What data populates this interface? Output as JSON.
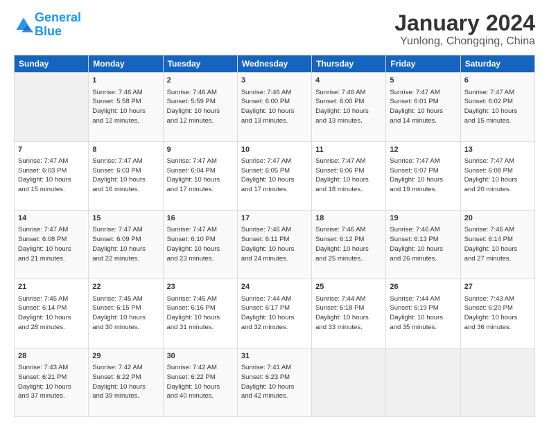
{
  "logo": {
    "text_general": "General",
    "text_blue": "Blue"
  },
  "header": {
    "title": "January 2024",
    "subtitle": "Yunlong, Chongqing, China"
  },
  "days_of_week": [
    "Sunday",
    "Monday",
    "Tuesday",
    "Wednesday",
    "Thursday",
    "Friday",
    "Saturday"
  ],
  "weeks": [
    [
      {
        "day": "",
        "sunrise": "",
        "sunset": "",
        "daylight": ""
      },
      {
        "day": "1",
        "sunrise": "Sunrise: 7:46 AM",
        "sunset": "Sunset: 5:58 PM",
        "daylight": "Daylight: 10 hours and 12 minutes."
      },
      {
        "day": "2",
        "sunrise": "Sunrise: 7:46 AM",
        "sunset": "Sunset: 5:59 PM",
        "daylight": "Daylight: 10 hours and 12 minutes."
      },
      {
        "day": "3",
        "sunrise": "Sunrise: 7:46 AM",
        "sunset": "Sunset: 6:00 PM",
        "daylight": "Daylight: 10 hours and 13 minutes."
      },
      {
        "day": "4",
        "sunrise": "Sunrise: 7:46 AM",
        "sunset": "Sunset: 6:00 PM",
        "daylight": "Daylight: 10 hours and 13 minutes."
      },
      {
        "day": "5",
        "sunrise": "Sunrise: 7:47 AM",
        "sunset": "Sunset: 6:01 PM",
        "daylight": "Daylight: 10 hours and 14 minutes."
      },
      {
        "day": "6",
        "sunrise": "Sunrise: 7:47 AM",
        "sunset": "Sunset: 6:02 PM",
        "daylight": "Daylight: 10 hours and 15 minutes."
      }
    ],
    [
      {
        "day": "7",
        "sunrise": "Sunrise: 7:47 AM",
        "sunset": "Sunset: 6:03 PM",
        "daylight": "Daylight: 10 hours and 15 minutes."
      },
      {
        "day": "8",
        "sunrise": "Sunrise: 7:47 AM",
        "sunset": "Sunset: 6:03 PM",
        "daylight": "Daylight: 10 hours and 16 minutes."
      },
      {
        "day": "9",
        "sunrise": "Sunrise: 7:47 AM",
        "sunset": "Sunset: 6:04 PM",
        "daylight": "Daylight: 10 hours and 17 minutes."
      },
      {
        "day": "10",
        "sunrise": "Sunrise: 7:47 AM",
        "sunset": "Sunset: 6:05 PM",
        "daylight": "Daylight: 10 hours and 17 minutes."
      },
      {
        "day": "11",
        "sunrise": "Sunrise: 7:47 AM",
        "sunset": "Sunset: 6:06 PM",
        "daylight": "Daylight: 10 hours and 18 minutes."
      },
      {
        "day": "12",
        "sunrise": "Sunrise: 7:47 AM",
        "sunset": "Sunset: 6:07 PM",
        "daylight": "Daylight: 10 hours and 19 minutes."
      },
      {
        "day": "13",
        "sunrise": "Sunrise: 7:47 AM",
        "sunset": "Sunset: 6:08 PM",
        "daylight": "Daylight: 10 hours and 20 minutes."
      }
    ],
    [
      {
        "day": "14",
        "sunrise": "Sunrise: 7:47 AM",
        "sunset": "Sunset: 6:08 PM",
        "daylight": "Daylight: 10 hours and 21 minutes."
      },
      {
        "day": "15",
        "sunrise": "Sunrise: 7:47 AM",
        "sunset": "Sunset: 6:09 PM",
        "daylight": "Daylight: 10 hours and 22 minutes."
      },
      {
        "day": "16",
        "sunrise": "Sunrise: 7:47 AM",
        "sunset": "Sunset: 6:10 PM",
        "daylight": "Daylight: 10 hours and 23 minutes."
      },
      {
        "day": "17",
        "sunrise": "Sunrise: 7:46 AM",
        "sunset": "Sunset: 6:11 PM",
        "daylight": "Daylight: 10 hours and 24 minutes."
      },
      {
        "day": "18",
        "sunrise": "Sunrise: 7:46 AM",
        "sunset": "Sunset: 6:12 PM",
        "daylight": "Daylight: 10 hours and 25 minutes."
      },
      {
        "day": "19",
        "sunrise": "Sunrise: 7:46 AM",
        "sunset": "Sunset: 6:13 PM",
        "daylight": "Daylight: 10 hours and 26 minutes."
      },
      {
        "day": "20",
        "sunrise": "Sunrise: 7:46 AM",
        "sunset": "Sunset: 6:14 PM",
        "daylight": "Daylight: 10 hours and 27 minutes."
      }
    ],
    [
      {
        "day": "21",
        "sunrise": "Sunrise: 7:45 AM",
        "sunset": "Sunset: 6:14 PM",
        "daylight": "Daylight: 10 hours and 28 minutes."
      },
      {
        "day": "22",
        "sunrise": "Sunrise: 7:45 AM",
        "sunset": "Sunset: 6:15 PM",
        "daylight": "Daylight: 10 hours and 30 minutes."
      },
      {
        "day": "23",
        "sunrise": "Sunrise: 7:45 AM",
        "sunset": "Sunset: 6:16 PM",
        "daylight": "Daylight: 10 hours and 31 minutes."
      },
      {
        "day": "24",
        "sunrise": "Sunrise: 7:44 AM",
        "sunset": "Sunset: 6:17 PM",
        "daylight": "Daylight: 10 hours and 32 minutes."
      },
      {
        "day": "25",
        "sunrise": "Sunrise: 7:44 AM",
        "sunset": "Sunset: 6:18 PM",
        "daylight": "Daylight: 10 hours and 33 minutes."
      },
      {
        "day": "26",
        "sunrise": "Sunrise: 7:44 AM",
        "sunset": "Sunset: 6:19 PM",
        "daylight": "Daylight: 10 hours and 35 minutes."
      },
      {
        "day": "27",
        "sunrise": "Sunrise: 7:43 AM",
        "sunset": "Sunset: 6:20 PM",
        "daylight": "Daylight: 10 hours and 36 minutes."
      }
    ],
    [
      {
        "day": "28",
        "sunrise": "Sunrise: 7:43 AM",
        "sunset": "Sunset: 6:21 PM",
        "daylight": "Daylight: 10 hours and 37 minutes."
      },
      {
        "day": "29",
        "sunrise": "Sunrise: 7:42 AM",
        "sunset": "Sunset: 6:22 PM",
        "daylight": "Daylight: 10 hours and 39 minutes."
      },
      {
        "day": "30",
        "sunrise": "Sunrise: 7:42 AM",
        "sunset": "Sunset: 6:22 PM",
        "daylight": "Daylight: 10 hours and 40 minutes."
      },
      {
        "day": "31",
        "sunrise": "Sunrise: 7:41 AM",
        "sunset": "Sunset: 6:23 PM",
        "daylight": "Daylight: 10 hours and 42 minutes."
      },
      {
        "day": "",
        "sunrise": "",
        "sunset": "",
        "daylight": ""
      },
      {
        "day": "",
        "sunrise": "",
        "sunset": "",
        "daylight": ""
      },
      {
        "day": "",
        "sunrise": "",
        "sunset": "",
        "daylight": ""
      }
    ]
  ]
}
